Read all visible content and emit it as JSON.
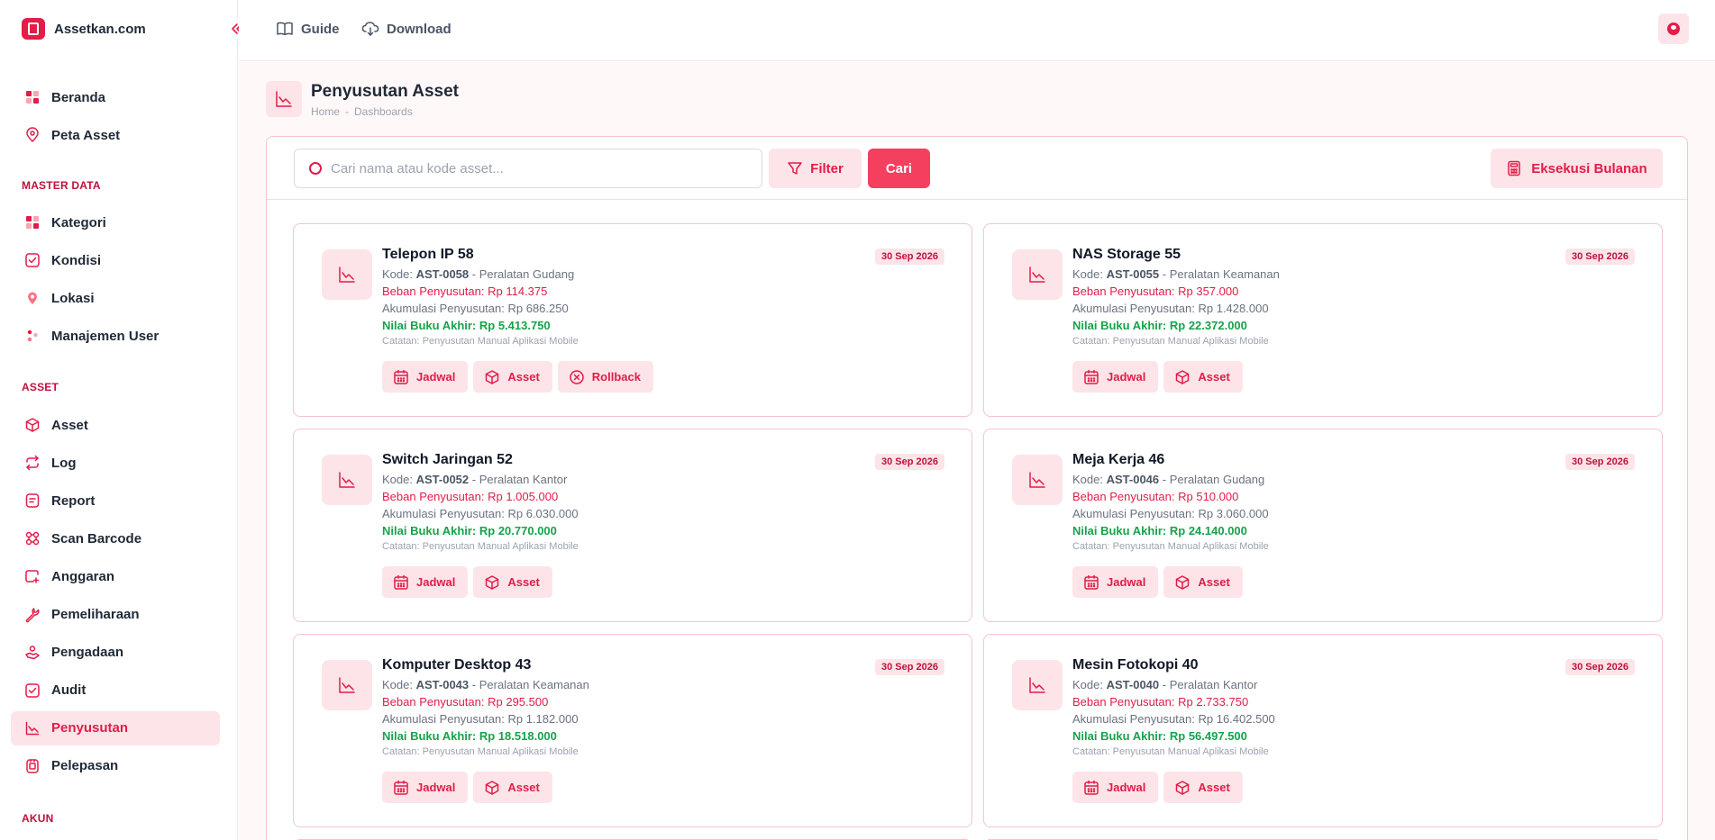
{
  "brand": {
    "name": "Assetkan.com"
  },
  "sidebar": {
    "top_items": [
      {
        "label": "Beranda",
        "icon": "grid-icon"
      },
      {
        "label": "Peta Asset",
        "icon": "map-pin-icon"
      }
    ],
    "sections": [
      {
        "title": "MASTER DATA",
        "items": [
          {
            "label": "Kategori",
            "icon": "grid-icon"
          },
          {
            "label": "Kondisi",
            "icon": "check-square-icon"
          },
          {
            "label": "Lokasi",
            "icon": "location-icon"
          },
          {
            "label": "Manajemen User",
            "icon": "users-icon"
          }
        ]
      },
      {
        "title": "ASSET",
        "items": [
          {
            "label": "Asset",
            "icon": "cube-icon"
          },
          {
            "label": "Log",
            "icon": "repeat-icon"
          },
          {
            "label": "Report",
            "icon": "report-icon"
          },
          {
            "label": "Scan Barcode",
            "icon": "scan-icon"
          },
          {
            "label": "Anggaran",
            "icon": "wallet-icon"
          },
          {
            "label": "Pemeliharaan",
            "icon": "wrench-icon"
          },
          {
            "label": "Pengadaan",
            "icon": "procurement-icon"
          },
          {
            "label": "Audit",
            "icon": "check-square-icon"
          },
          {
            "label": "Penyusutan",
            "icon": "chart-line-icon",
            "active": true
          },
          {
            "label": "Pelepasan",
            "icon": "release-icon"
          }
        ]
      },
      {
        "title": "AKUN",
        "items": []
      }
    ]
  },
  "topbar": {
    "guide_label": "Guide",
    "download_label": "Download"
  },
  "page": {
    "title": "Penyusutan Asset",
    "breadcrumb": [
      "Home",
      "-",
      "Dashboards"
    ]
  },
  "toolbar": {
    "search_placeholder": "Cari nama atau kode asset...",
    "filter_label": "Filter",
    "search_button_label": "Cari",
    "execute_label": "Eksekusi Bulanan"
  },
  "labels": {
    "kode": "Kode:",
    "beban": "Beban Penyusutan:",
    "akumulasi": "Akumulasi Penyusutan:",
    "nilai": "Nilai Buku Akhir:",
    "catatan": "Catatan:",
    "jadwal": "Jadwal",
    "asset": "Asset",
    "rollback": "Rollback"
  },
  "cards": [
    {
      "name": "Telepon IP 58",
      "kode": "AST-0058",
      "kategori": "Peralatan Gudang",
      "beban": "Rp 114.375",
      "akumulasi": "Rp 686.250",
      "nilai": "Rp 5.413.750",
      "catatan": "Penyusutan Manual Aplikasi Mobile",
      "date": "30 Sep 2026",
      "rollback": true
    },
    {
      "name": "NAS Storage 55",
      "kode": "AST-0055",
      "kategori": "Peralatan Keamanan",
      "beban": "Rp 357.000",
      "akumulasi": "Rp 1.428.000",
      "nilai": "Rp 22.372.000",
      "catatan": "Penyusutan Manual Aplikasi Mobile",
      "date": "30 Sep 2026",
      "rollback": false
    },
    {
      "name": "Switch Jaringan 52",
      "kode": "AST-0052",
      "kategori": "Peralatan Kantor",
      "beban": "Rp 1.005.000",
      "akumulasi": "Rp 6.030.000",
      "nilai": "Rp 20.770.000",
      "catatan": "Penyusutan Manual Aplikasi Mobile",
      "date": "30 Sep 2026",
      "rollback": false
    },
    {
      "name": "Meja Kerja 46",
      "kode": "AST-0046",
      "kategori": "Peralatan Gudang",
      "beban": "Rp 510.000",
      "akumulasi": "Rp 3.060.000",
      "nilai": "Rp 24.140.000",
      "catatan": "Penyusutan Manual Aplikasi Mobile",
      "date": "30 Sep 2026",
      "rollback": false
    },
    {
      "name": "Komputer Desktop 43",
      "kode": "AST-0043",
      "kategori": "Peralatan Keamanan",
      "beban": "Rp 295.500",
      "akumulasi": "Rp 1.182.000",
      "nilai": "Rp 18.518.000",
      "catatan": "Penyusutan Manual Aplikasi Mobile",
      "date": "30 Sep 2026",
      "rollback": false
    },
    {
      "name": "Mesin Fotokopi 40",
      "kode": "AST-0040",
      "kategori": "Peralatan Kantor",
      "beban": "Rp 2.733.750",
      "akumulasi": "Rp 16.402.500",
      "nilai": "Rp 56.497.500",
      "catatan": "Penyusutan Manual Aplikasi Mobile",
      "date": "30 Sep 2026",
      "rollback": false
    }
  ],
  "colors": {
    "accent": "#e11d48",
    "accent_soft": "#fde4e8",
    "success": "#16a34a"
  }
}
